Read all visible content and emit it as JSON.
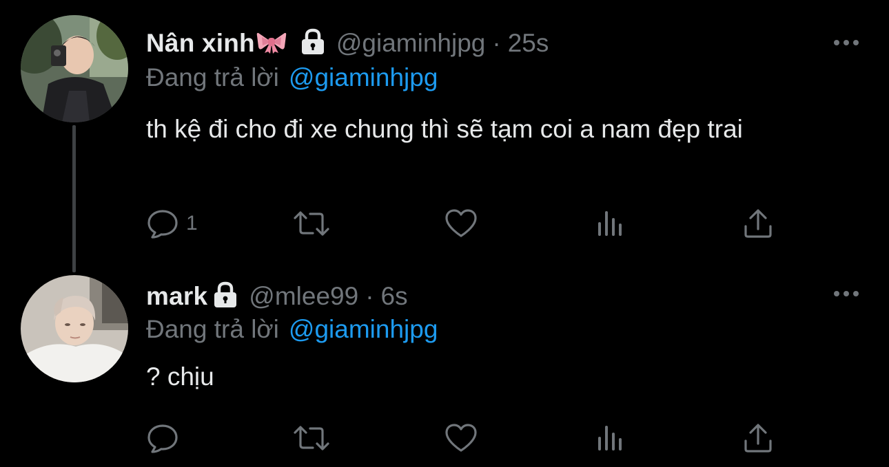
{
  "colors": {
    "background": "#000000",
    "text_primary": "#e7e9ea",
    "text_secondary": "#71767b",
    "link": "#1d9bf0",
    "thread_line": "#3e4144"
  },
  "tweets": [
    {
      "display_name": "Nân xinh",
      "name_emoji": "ribbon-bow-emoji",
      "protected": true,
      "handle": "@giaminhjpg",
      "separator": "·",
      "time": "25s",
      "reply_prefix": "Đang trả lời",
      "reply_to": "@giaminhjpg",
      "text": "th kệ đi cho đi xe chung thì sẽ tạm coi a nam đẹp trai",
      "reply_count": "1",
      "retweet_count": "",
      "like_count": "",
      "view_count": ""
    },
    {
      "display_name": "mark",
      "protected": true,
      "handle": "@mlee99",
      "separator": "·",
      "time": "6s",
      "reply_prefix": "Đang trả lời",
      "reply_to": "@giaminhjpg",
      "text": "? chịu",
      "reply_count": "",
      "retweet_count": "",
      "like_count": "",
      "view_count": ""
    }
  ]
}
